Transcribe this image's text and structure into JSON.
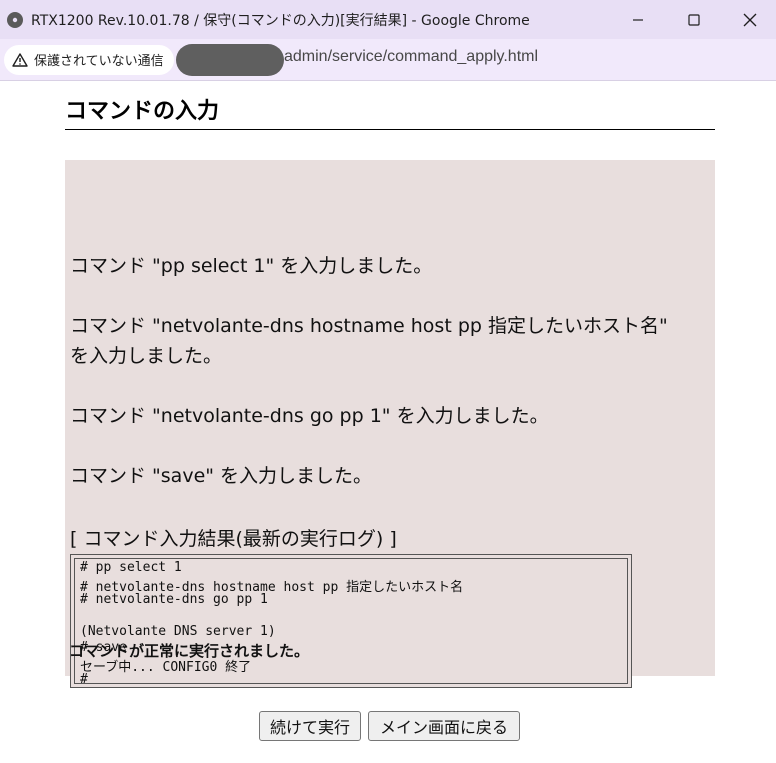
{
  "window": {
    "title": "RTX1200 Rev.10.01.78 / 保守(コマンドの入力)[実行結果] - Google Chrome",
    "minimize_icon": "minimize-icon",
    "maximize_icon": "maximize-icon",
    "close_icon": "close-icon"
  },
  "address_bar": {
    "security_label": "保護されていない通信",
    "url": "admin/service/command_apply.html"
  },
  "page": {
    "heading": "コマンドの入力",
    "messages": [
      "コマンド \"pp select 1\" を入力しました。",
      "コマンド \"netvolante-dns hostname host pp 指定したいホスト名\"",
      "を入力しました。",
      "コマンド \"netvolante-dns go pp 1\" を入力しました。",
      "コマンド \"save\" を入力しました。"
    ],
    "log_title": "[ コマンド入力結果(最新の実行ログ) ]",
    "log_lines": [
      "# pp select 1",
      "# netvolante-dns hostname host pp 指定したいホスト名",
      "# netvolante-dns go pp 1",
      "",
      "(Netvolante DNS server 1)",
      "# save",
      "セーブ中... CONFIG0 終了",
      "#"
    ],
    "success_message": "コマンドが正常に実行されました。",
    "buttons": {
      "continue": "続けて実行",
      "back_to_main": "メイン画面に戻る"
    }
  }
}
